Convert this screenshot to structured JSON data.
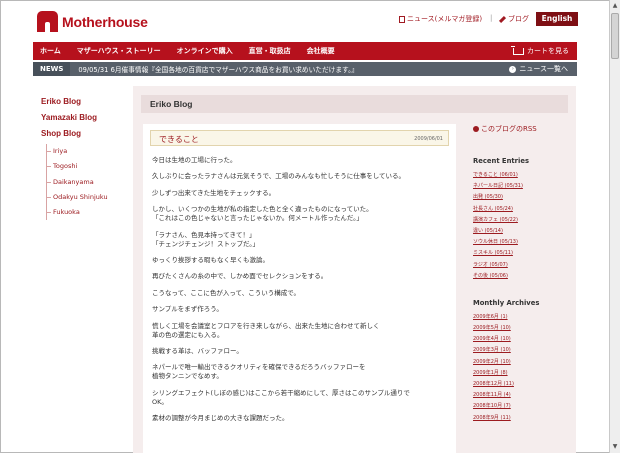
{
  "header": {
    "logo_text": "Motherhouse",
    "news_link": "ニュース(メルマガ登録)",
    "separator": "|",
    "blog_link": "ブログ",
    "english_button": "English"
  },
  "nav": {
    "items": [
      "ホーム",
      "マザーハウス・ストーリー",
      "オンラインで購入",
      "直営・取扱店",
      "会社概要"
    ],
    "cart": "カートを見る"
  },
  "newsbar": {
    "label": "NEWS",
    "text": "09/05/31 6月催事情報『全国各地の百貨店でマザーハウス商品をお買い求めいただけます。』",
    "more": "ニュース一覧へ"
  },
  "left_sidebar": {
    "blogs": [
      "Eriko Blog",
      "Yamazaki Blog",
      "Shop Blog"
    ],
    "shops": [
      "Iriya",
      "Togoshi",
      "Daikanyama",
      "Odakyu Shinjuku",
      "Fukuoka"
    ]
  },
  "main": {
    "title": "Eriko Blog",
    "entry_title": "できること",
    "entry_date": "2009/06/01",
    "paragraphs": [
      "今日は生地の工場に行った。",
      "久しぶりに会ったラナさんは元気そうで、工場のみんなも忙しそうに仕事をしている。",
      "少しずつ出来てきた生地をチェックする。",
      "しかし、いくつかの生地が私の指定した色と全く違ったものになっていた。\n「これはこの色じゃないと言ったじゃないか。何メートル作ったんだ。」",
      "「ラナさん、色見本持ってきて！」\n「チェンジチェンジ！ストップだ。」",
      "ゆっくり挨拶する暇もなく早くも激論。",
      "再びたくさんの糸の中で、しかめ面でセレクションをする。",
      "こうなって、ここに色が入って、こういう構成で。",
      "サンプルをまず作ろう。",
      "慌しく工場を会議室とフロアを行き来しながら、出来た生地に合わせて新しく\n革の色の選定にも入る。",
      "挑戦する革は、バッファロー。",
      "ネパールで唯一輸出できるクオリティを確保できるだろうバッファローを\n植物タンニンでなめす。",
      "シリングエフェクト(しぼの感じ)はここから若干縮めにして、厚さはこのサンプル通りで\nOK。",
      "素材の調整が今月まじめの大きな課題だった。"
    ]
  },
  "right_sidebar": {
    "rss": "このブログのRSS",
    "recent_heading": "Recent Entries",
    "recent": [
      "できること (06/01)",
      "ネパール日記 (05/31)",
      "出発 (05/30)",
      "社長さん (05/24)",
      "講演カフェ (05/22)",
      "違い (05/14)",
      "ソウル休日 (05/13)",
      "ミスキル (05/11)",
      "ラジオ (05/07)",
      "その後 (05/06)"
    ],
    "archives_heading": "Monthly Archives",
    "archives": [
      "2009年6月 (1)",
      "2009年5月 (10)",
      "2009年4月 (10)",
      "2009年3月 (10)",
      "2009年2月 (10)",
      "2009年1月 (8)",
      "2008年12月 (11)",
      "2008年11月 (4)",
      "2008年10月 (7)",
      "2008年9月 (11)"
    ]
  },
  "colors": {
    "brand_red": "#b6111d",
    "dark_red": "#7e0f14",
    "news_gray": "#58606a",
    "panel_bg": "#f5eded"
  }
}
